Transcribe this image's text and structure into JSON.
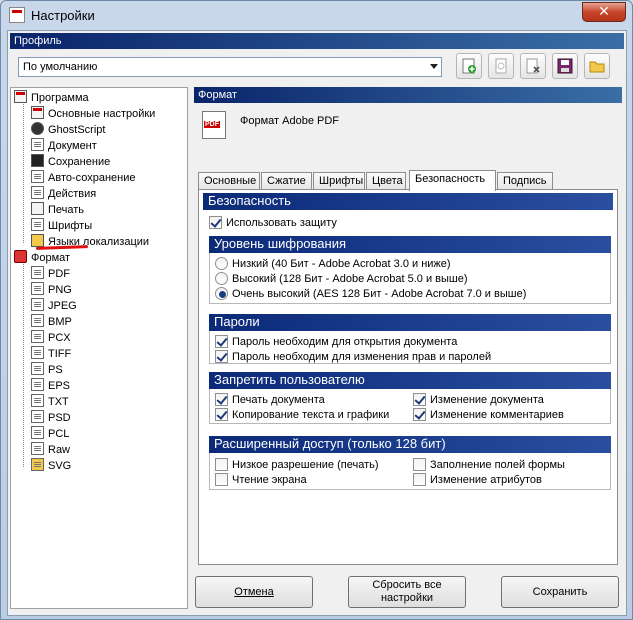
{
  "window": {
    "title": "Настройки",
    "close_glyph": "✕"
  },
  "profile": {
    "label": "Профиль",
    "selected": "По умолчанию"
  },
  "toolbar": {
    "icons": [
      "add-profile-icon",
      "rename-profile-icon",
      "delete-profile-icon",
      "save-icon",
      "open-folder-icon"
    ]
  },
  "tree": {
    "program": {
      "label": "Программа",
      "items": [
        "Основные настройки",
        "GhostScript",
        "Документ",
        "Сохранение",
        "Авто-сохранение",
        "Действия",
        "Печать",
        "Шрифты",
        "Языки локализации"
      ]
    },
    "format": {
      "label": "Формат",
      "items": [
        "PDF",
        "PNG",
        "JPEG",
        "BMP",
        "PCX",
        "TIFF",
        "PS",
        "EPS",
        "TXT",
        "PSD",
        "PCL",
        "Raw",
        "SVG"
      ]
    }
  },
  "format_panel": {
    "header": "Формат",
    "title": "Формат Adobe PDF"
  },
  "tabs": [
    "Основные",
    "Сжатие",
    "Шрифты",
    "Цвета",
    "Безопасность",
    "Подпись"
  ],
  "active_tab": "Безопасность",
  "security": {
    "header": "Безопасность",
    "use_protection": {
      "label": "Использовать защиту",
      "checked": true
    },
    "encryption": {
      "header": "Уровень шифрования",
      "options": [
        {
          "label": "Низкий (40 Бит - Adobe Acrobat 3.0 и ниже)",
          "selected": false
        },
        {
          "label": "Высокий (128 Бит - Adobe Acrobat 5.0 и выше)",
          "selected": false
        },
        {
          "label": "Очень высокий (AES 128 Бит - Adobe Acrobat 7.0 и выше)",
          "selected": true
        }
      ]
    },
    "passwords": {
      "header": "Пароли",
      "items": [
        {
          "label": "Пароль необходим для открытия документа",
          "checked": true
        },
        {
          "label": "Пароль необходим для изменения прав и паролей",
          "checked": true
        }
      ]
    },
    "deny": {
      "header": "Запретить пользователю",
      "items": [
        {
          "label": "Печать документа",
          "checked": true
        },
        {
          "label": "Изменение документа",
          "checked": true
        },
        {
          "label": "Копирование текста и графики",
          "checked": true
        },
        {
          "label": "Изменение комментариев",
          "checked": true
        }
      ]
    },
    "extended": {
      "header": "Расширенный доступ (только 128 бит)",
      "items": [
        {
          "label": "Низкое разрешение (печать)",
          "checked": false
        },
        {
          "label": "Заполнение полей формы",
          "checked": false
        },
        {
          "label": "Чтение экрана",
          "checked": false
        },
        {
          "label": "Изменение атрибутов",
          "checked": false
        }
      ]
    }
  },
  "buttons": {
    "cancel": "Отмена",
    "reset": "Сбросить все настройки",
    "save": "Сохранить"
  }
}
